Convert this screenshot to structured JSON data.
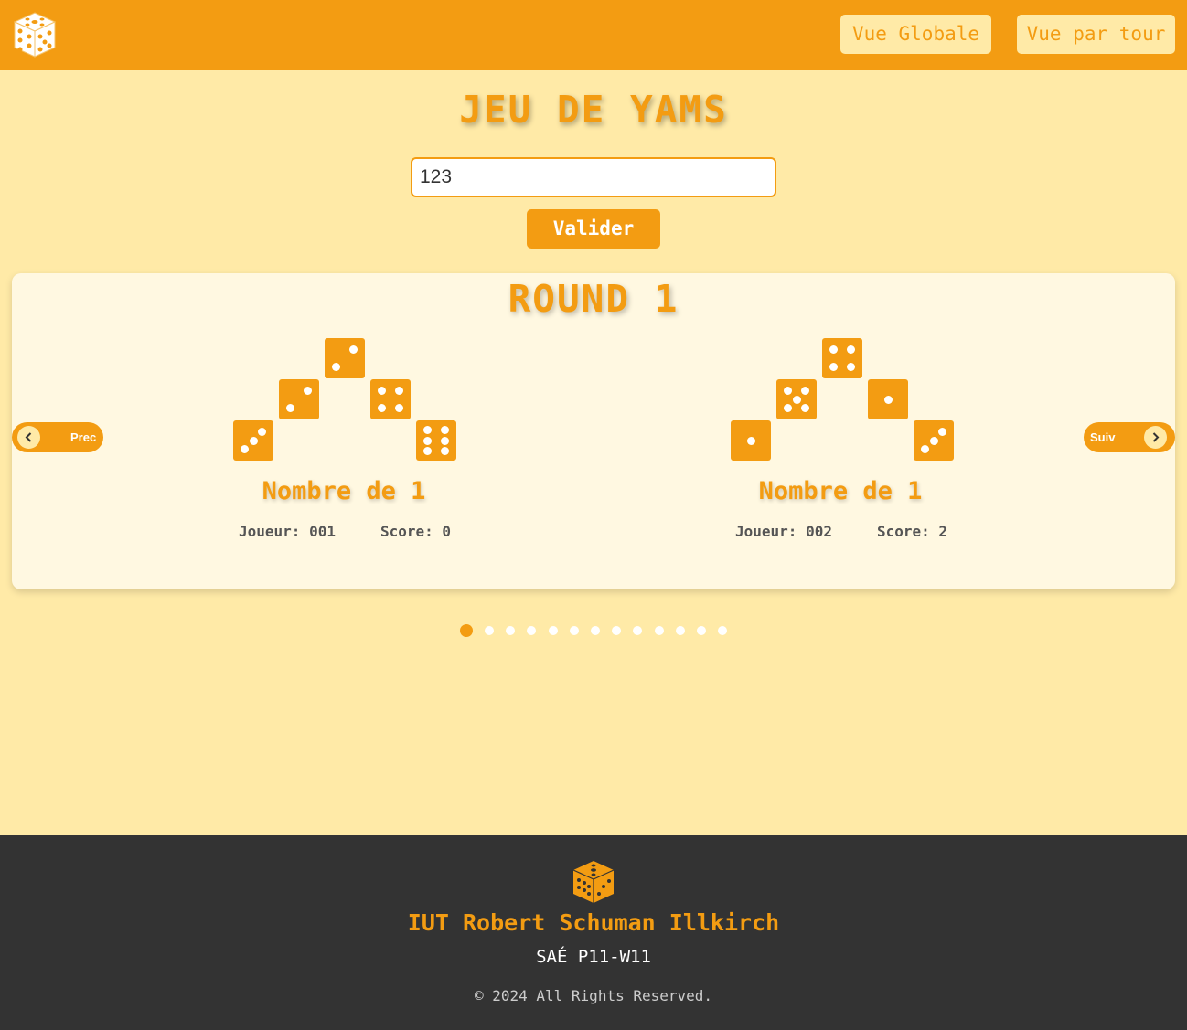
{
  "header": {
    "nav": [
      {
        "label": "Vue Globale"
      },
      {
        "label": "Vue par tour"
      }
    ]
  },
  "page": {
    "title": "JEU DE YAMS"
  },
  "form": {
    "input_value": "123",
    "submit_label": "Valider"
  },
  "carousel": {
    "round_title": "ROUND 1",
    "prev_label": "Prec",
    "next_label": "Suiv",
    "slides": [
      {
        "dice": [
          3,
          2,
          2,
          4,
          6
        ],
        "combination": "Nombre de 1",
        "player": "Joueur: 001",
        "score": "Score: 0"
      },
      {
        "dice": [
          1,
          5,
          4,
          1,
          3
        ],
        "combination": "Nombre de 1",
        "player": "Joueur: 002",
        "score": "Score: 2"
      }
    ],
    "indicator_count": 13,
    "active_indicator": 0
  },
  "footer": {
    "school": "IUT Robert Schuman Illkirch",
    "sae": "SAÉ P11-W11",
    "copyright": "© 2024 All Rights Reserved."
  },
  "colors": {
    "accent": "#f39c12",
    "background": "#ffeaa7",
    "card": "#fff8e1",
    "footer": "#333333"
  }
}
